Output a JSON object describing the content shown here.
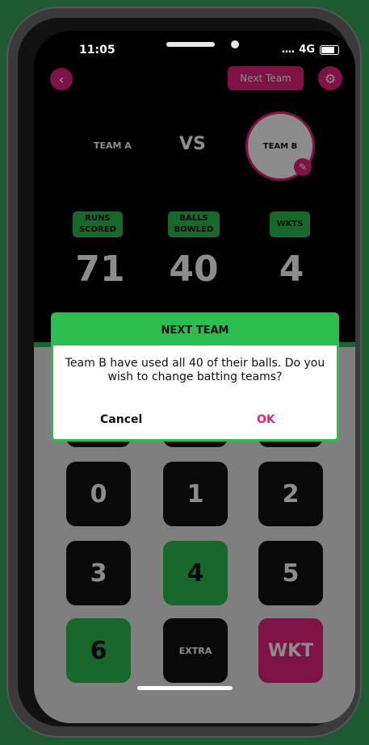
{
  "status_bar": {
    "time": "11:05",
    "signal": "....",
    "network": "4G"
  },
  "header": {
    "next_team_label": "Next Team"
  },
  "teams": {
    "team_a": "TEAM A",
    "vs": "VS",
    "team_b": "TEAM B"
  },
  "stats": {
    "runs_label": "RUNS SCORED",
    "balls_label": "BALLS BOWLED",
    "wkts_label": "WKTS",
    "runs": "71",
    "balls": "40",
    "wkts": "4"
  },
  "keypad": {
    "k0": "0",
    "k1": "1",
    "k2": "2",
    "k3": "3",
    "k4": "4",
    "k5": "5",
    "k6": "6",
    "extra": "EXTRA",
    "wkt": "WKT"
  },
  "dialog": {
    "title": "NEXT TEAM",
    "message": "Team B have used all 40 of their balls. Do you wish to change batting teams?",
    "cancel": "Cancel",
    "ok": "OK"
  },
  "colors": {
    "accent_pink": "#e5217e",
    "accent_green": "#2bbd4d",
    "background": "#1e5a30"
  }
}
